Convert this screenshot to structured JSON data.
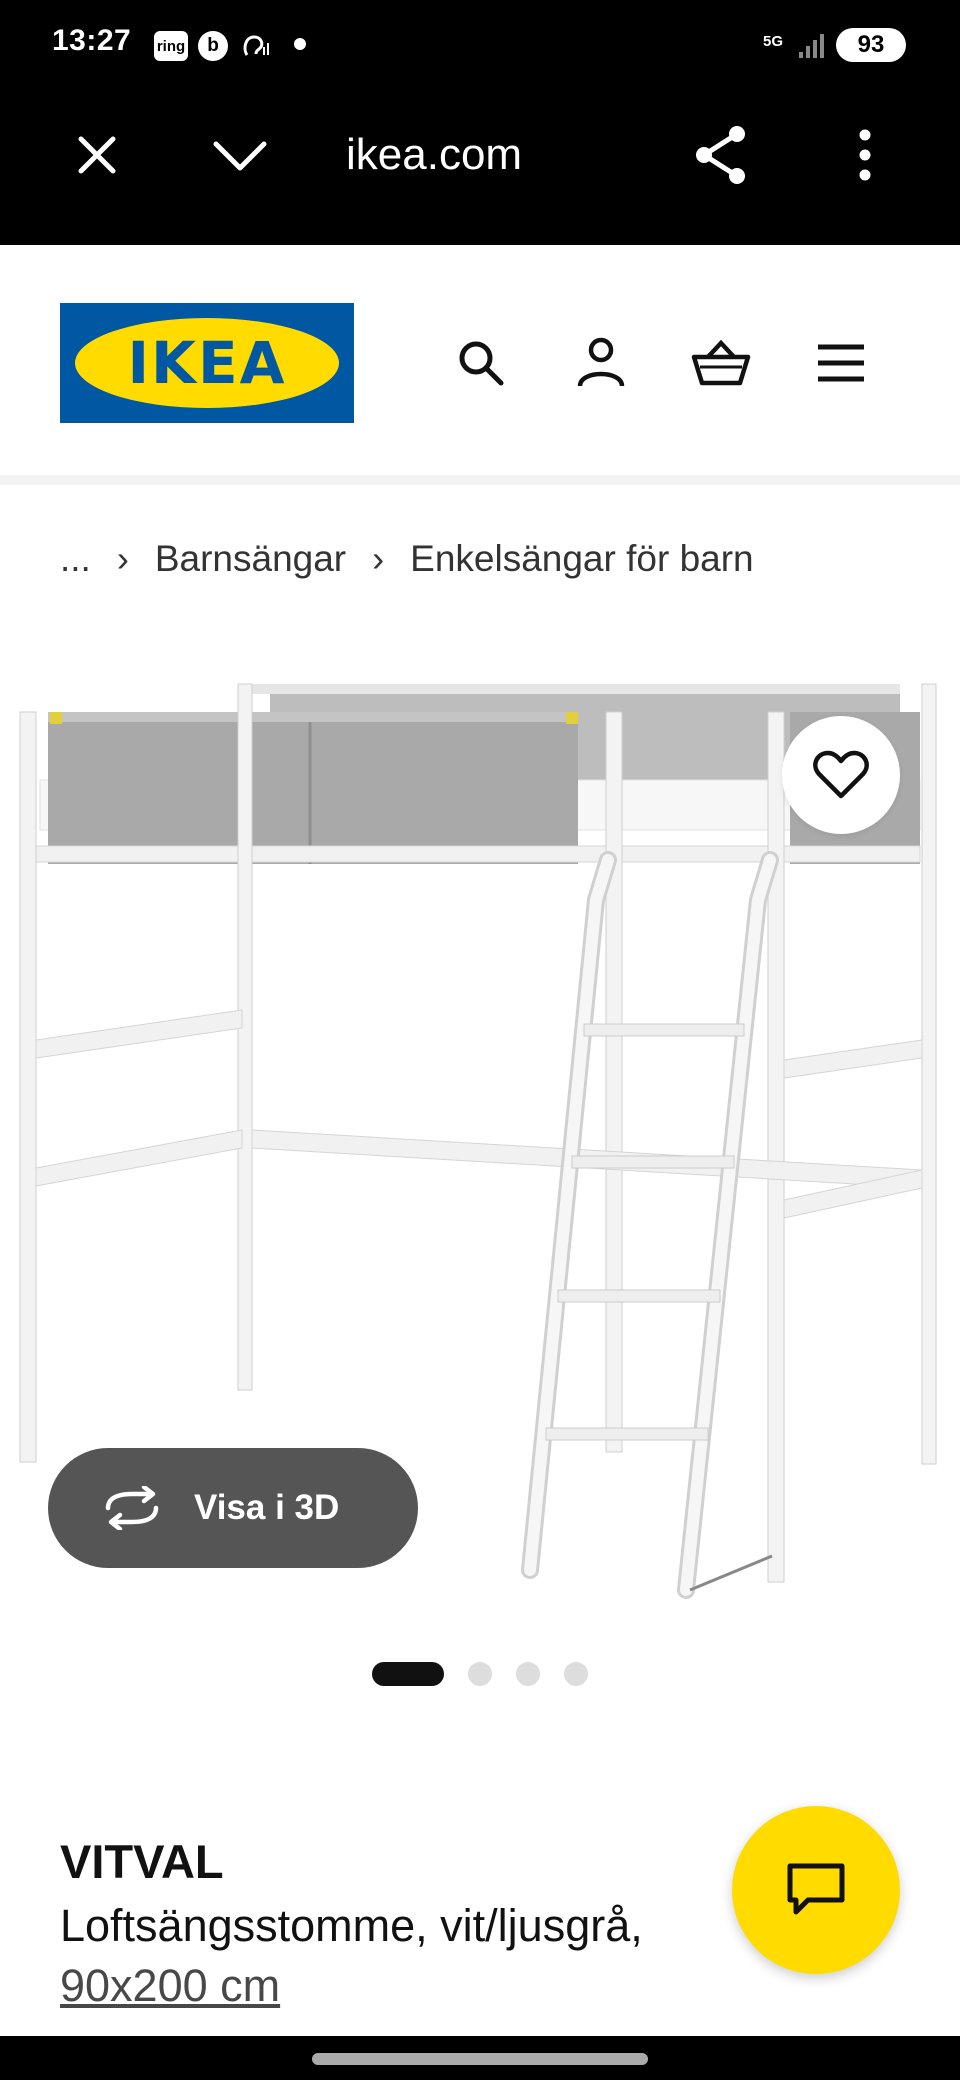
{
  "status_bar": {
    "time": "13:27",
    "ring_label": "ring",
    "b_label": "b",
    "network": "5G",
    "battery": "93"
  },
  "browser": {
    "url": "ikea.com",
    "icons": [
      "close-icon",
      "chevron-down-icon",
      "share-icon",
      "more-vertical-icon"
    ]
  },
  "header": {
    "logo_text": "IKEA",
    "icons": [
      "search-icon",
      "user-icon",
      "cart-icon",
      "menu-icon"
    ],
    "brand_blue": "#0058a3",
    "brand_yellow": "#ffdb00"
  },
  "breadcrumb": {
    "ellipsis": "...",
    "items": [
      "Barnsängar",
      "Enkelsängar för barn"
    ]
  },
  "gallery": {
    "view_3d_label": "Visa i 3D",
    "current_image": 1,
    "image_count": 4
  },
  "product": {
    "name": "VITVAL",
    "description": "Loftsängsstomme, vit/ljusgrå,",
    "size": "90x200 cm"
  }
}
